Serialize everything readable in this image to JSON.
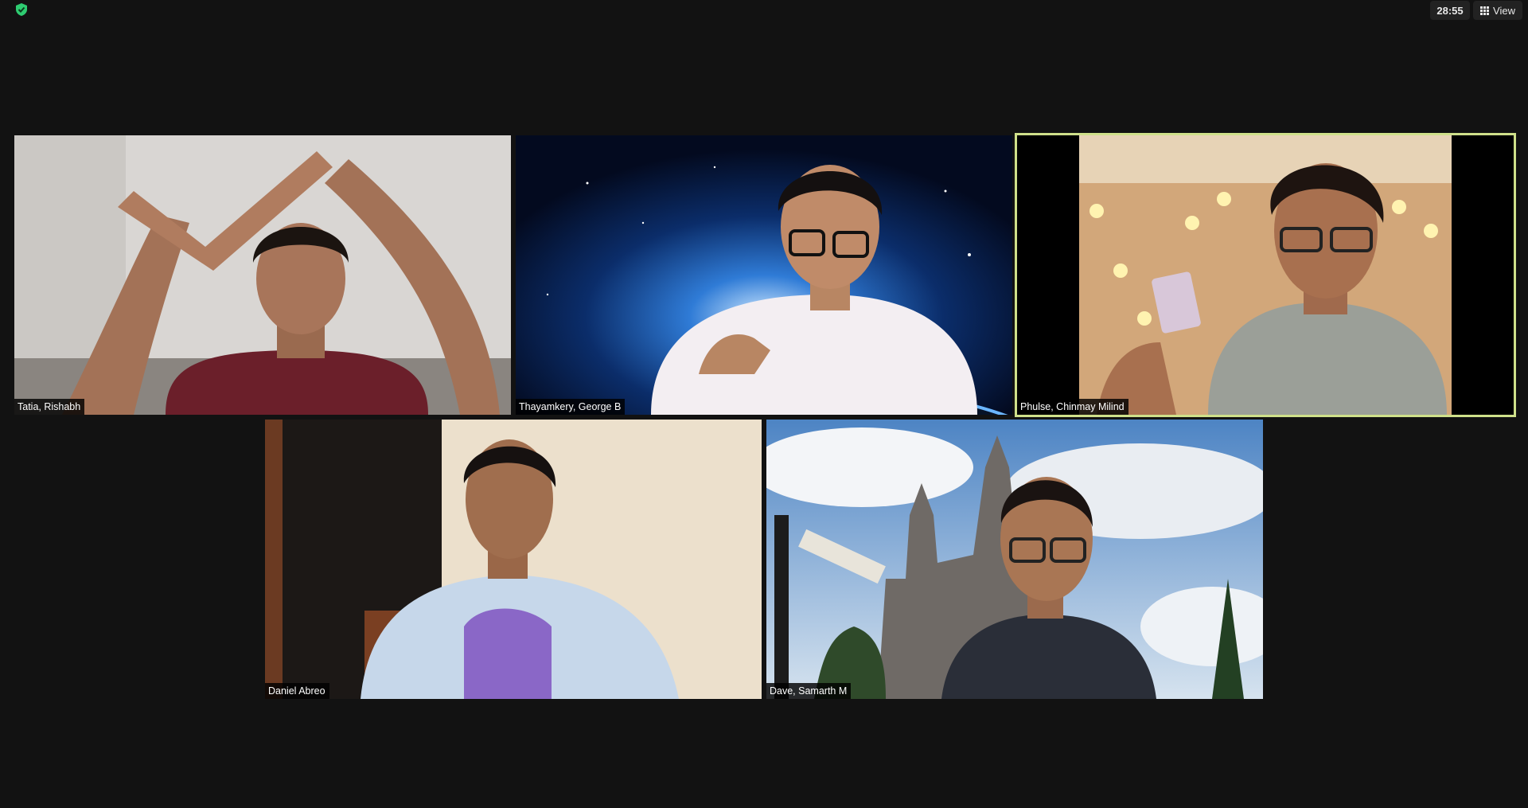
{
  "toolbar": {
    "security_icon": "shield-check-icon",
    "timer": "28:55",
    "view_label": "View",
    "view_icon": "grid-icon"
  },
  "participants": [
    {
      "name": "Tatia, Rishabh",
      "background": "home-room",
      "active": false
    },
    {
      "name": "Thayamkery, George B",
      "background": "virtual-earth-space",
      "active": false
    },
    {
      "name": "Phulse, Chinmay Milind",
      "background": "room-with-string-lights",
      "active": true
    },
    {
      "name": "Daniel Abreo",
      "background": "dorm-room",
      "active": false
    },
    {
      "name": "Dave, Samarth M",
      "background": "virtual-hogwarts-castle",
      "active": false
    }
  ],
  "colors": {
    "window_bg": "#121212",
    "active_speaker_border": "#cfe08a",
    "security_green": "#2ecc71"
  }
}
